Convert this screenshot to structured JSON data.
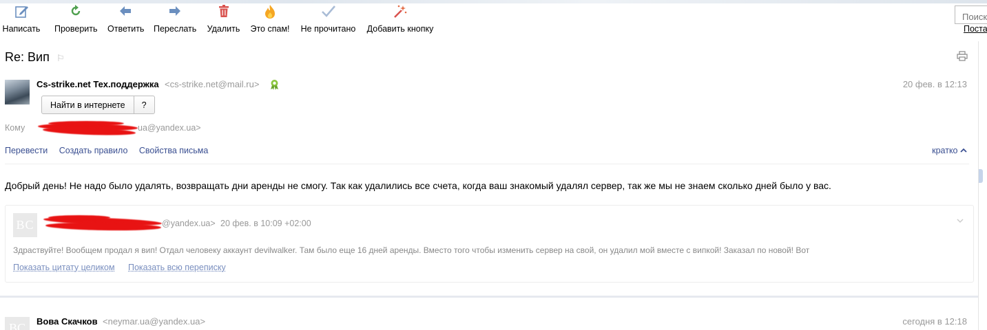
{
  "toolbar": {
    "buttons": [
      {
        "label": "Написать",
        "icon": "compose-icon"
      },
      {
        "label": "Проверить",
        "icon": "refresh-icon"
      },
      {
        "label": "Ответить",
        "icon": "reply-icon"
      },
      {
        "label": "Переслать",
        "icon": "forward-icon"
      },
      {
        "label": "Удалить",
        "icon": "trash-icon"
      },
      {
        "label": "Это спам!",
        "icon": "spam-fire-icon"
      },
      {
        "label": "Не прочитано",
        "icon": "unread-check-icon"
      },
      {
        "label": "Добавить кнопку",
        "icon": "magic-wand-icon"
      }
    ],
    "search_placeholder": "Поиск",
    "post_link": "Поста"
  },
  "message": {
    "subject": "Re: Вип",
    "sender_name": "Cs-strike.net Тех.поддержка",
    "sender_email": "<cs-strike.net@mail.ru>",
    "date": "20 фев. в 12:13",
    "find_button": "Найти в интернете",
    "help_button": "?",
    "to_label": "Кому",
    "to_email": "ua@yandex.ua>",
    "actions": [
      "Перевести",
      "Создать правило",
      "Свойства письма"
    ],
    "collapse_label": "кратко",
    "body": "Добрый день! Не надо было удалять, возвращать дни аренды не смогу. Так как удалились все счета, когда ваш знакомый удалял сервер, так же мы не знаем сколько дней было у вас."
  },
  "quote": {
    "avatar_initials": "BC",
    "email": "@yandex.ua>",
    "date": "20 фев. в 10:09 +02:00",
    "text": "Здраствуйте! Вообщем продал я вип! Отдал человеку аккаунт devilwalker. Там было еще 16 дней аренды. Вместо того чтобы изменить сервер на свой, он удалил мой вместе с випкой! Заказал по новой! Вот",
    "show_full": "Показать цитату целиком",
    "show_thread": "Показать всю переписку"
  },
  "next_message": {
    "avatar_initials": "BC",
    "sender_name": "Вова Скачков",
    "sender_email": "<neymar.ua@yandex.ua>",
    "date": "сегодня в 12:18"
  },
  "colors": {
    "link": "#3a4f91",
    "muted": "#999999",
    "redaction": "#e81313"
  }
}
